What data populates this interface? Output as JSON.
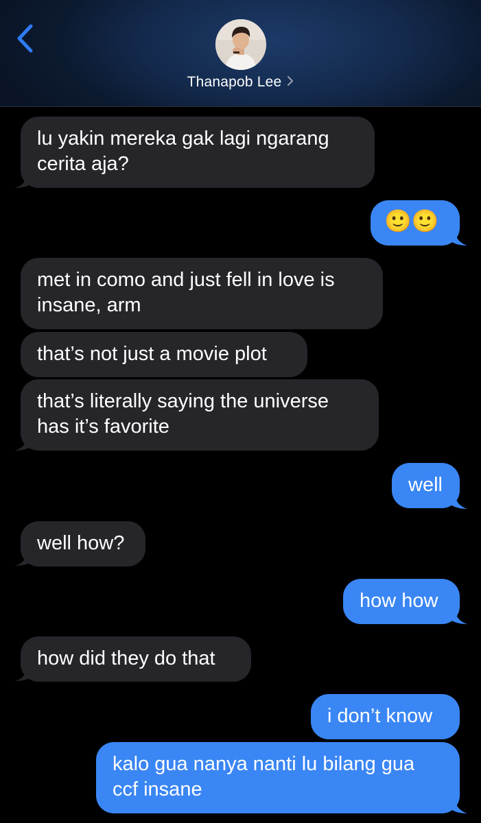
{
  "header": {
    "contact_name": "Thanapob Lee",
    "chevron": "chevron-right-icon",
    "back": "chevron-left-icon"
  },
  "colors": {
    "incoming_bubble": "#26262a",
    "outgoing_bubble": "#3a86f4",
    "accent": "#2f7cf6"
  },
  "messages": [
    {
      "direction": "incoming",
      "text": "lu yakin mereka gak lagi ngarang\ncerita aja?"
    },
    {
      "direction": "outgoing",
      "text": "🙂🙂"
    },
    {
      "direction": "incoming",
      "text": "met in como and just fell in love is\ninsane, arm"
    },
    {
      "direction": "incoming",
      "text": "that’s not just a movie plot"
    },
    {
      "direction": "incoming",
      "text": "that’s literally saying the universe\nhas it’s favorite"
    },
    {
      "direction": "outgoing",
      "text": "well"
    },
    {
      "direction": "incoming",
      "text": "well how?"
    },
    {
      "direction": "outgoing",
      "text": "how how"
    },
    {
      "direction": "incoming",
      "text": "how did they do that"
    },
    {
      "direction": "outgoing",
      "text": "i don’t know"
    },
    {
      "direction": "outgoing",
      "text": "kalo gua nanya nanti lu bilang gua\nccf insane"
    }
  ]
}
